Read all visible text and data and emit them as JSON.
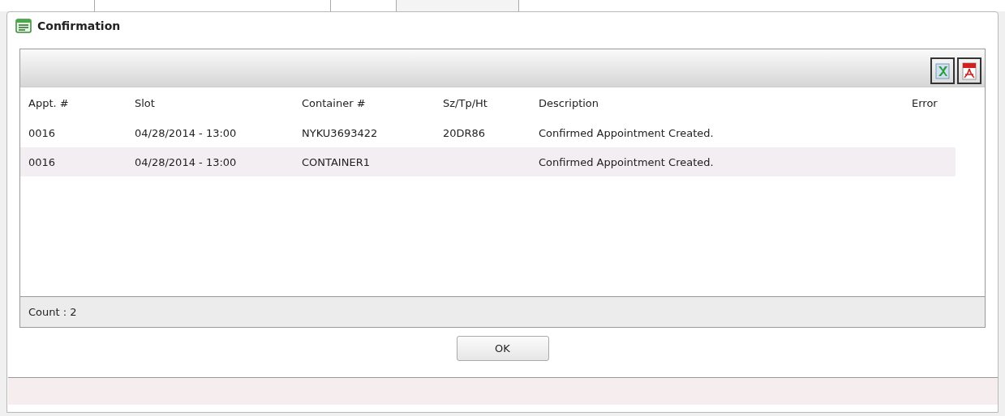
{
  "window": {
    "title": "Confirmation"
  },
  "toolbar": {
    "buttons": [
      {
        "kind": "excel"
      },
      {
        "kind": "pdf"
      }
    ]
  },
  "table": {
    "columns": [
      "Appt. #",
      "Slot",
      "Container #",
      "Sz/Tp/Ht",
      "Description",
      "Error"
    ],
    "rows": [
      {
        "cells": [
          "0016",
          "04/28/2014 - 13:00",
          "NYKU3693422",
          "20DR86",
          "Confirmed Appointment Created.",
          ""
        ],
        "alternate": false
      },
      {
        "cells": [
          "0016",
          "04/28/2014 - 13:00",
          "CONTAINER1",
          "",
          "Confirmed Appointment Created.",
          ""
        ],
        "alternate": true
      }
    ]
  },
  "footer": {
    "count": "Count : 2"
  },
  "buttons": [
    {
      "label": "OK"
    }
  ]
}
